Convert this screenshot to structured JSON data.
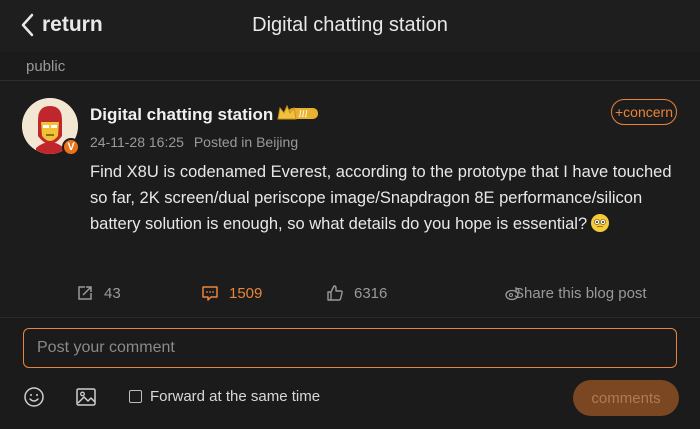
{
  "header": {
    "back_label": "return",
    "title": "Digital chatting station"
  },
  "section_label": "public",
  "post": {
    "username": "Digital chatting station",
    "badge": "V",
    "timestamp": "24-11-28 16:25",
    "location": "Posted in Beijing",
    "follow_label": "+concern",
    "content": "Find X8U is codenamed Everest, according to the prototype that I have touched so far, 2K screen/dual periscope image/Snapdragon 8E performance/silicon battery solution is enough, so what details do you hope is essential?",
    "actions": {
      "share_count": "43",
      "comment_count": "1509",
      "like_count": "6316",
      "share_blog_label": "Share this blog post"
    }
  },
  "composer": {
    "placeholder": "Post your comment",
    "forward_label": "Forward at the same time",
    "submit_label": "comments"
  },
  "colors": {
    "accent": "#e8853a",
    "background": "#1b1b1b",
    "muted_text": "#9a9a9a"
  },
  "icons": [
    "chevron-left-icon",
    "crown-icon",
    "share-icon",
    "comment-icon",
    "thumbs-up-icon",
    "weibo-share-icon",
    "emoji-icon",
    "image-icon"
  ]
}
